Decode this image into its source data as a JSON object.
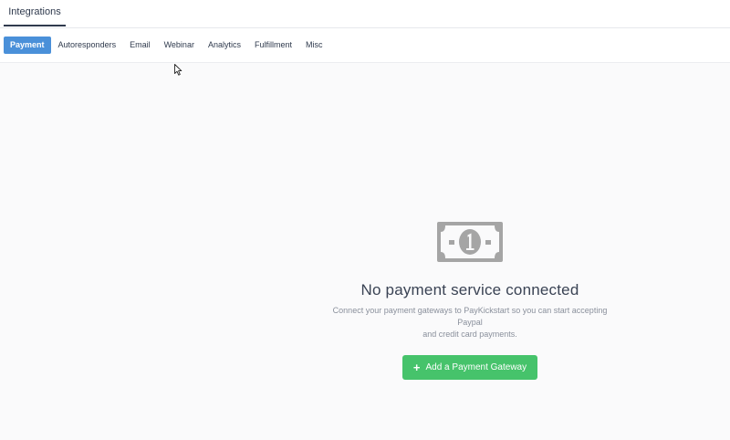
{
  "header": {
    "tab_label": "Integrations"
  },
  "subtabs": [
    {
      "label": "Payment",
      "active": true
    },
    {
      "label": "Autoresponders",
      "active": false
    },
    {
      "label": "Email",
      "active": false
    },
    {
      "label": "Webinar",
      "active": false
    },
    {
      "label": "Analytics",
      "active": false
    },
    {
      "label": "Fulfillment",
      "active": false
    },
    {
      "label": "Misc",
      "active": false
    }
  ],
  "empty_state": {
    "icon": "money-bill-icon",
    "title": "No payment service connected",
    "description_line1": "Connect your payment gateways to PayKickstart so you can start accepting",
    "description_line2": "Paypal",
    "description_line3": "and credit card payments.",
    "button_label": "Add a Payment Gateway",
    "button_icon": "plus-icon"
  },
  "colors": {
    "accent": "#4a90d9",
    "button": "#46c36b",
    "icon": "#a5a5a5",
    "text_dark": "#2f3a4d",
    "text_muted": "#8a909c"
  }
}
